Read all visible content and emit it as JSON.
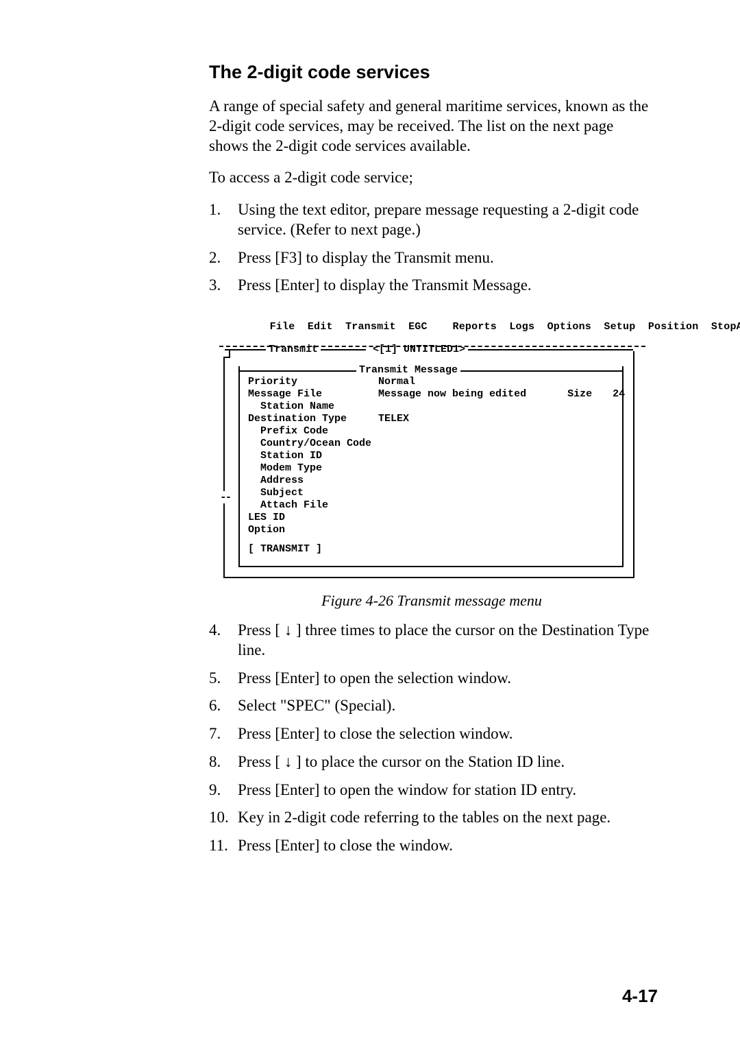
{
  "heading": "The 2-digit code services",
  "intro1": "A range of special safety and general maritime services, known as the 2-digit code services, may be received. The list on the next page shows the 2-digit code services available.",
  "intro2": "To access a 2-digit code service;",
  "stepsA": [
    "Using the text editor, prepare message requesting a 2-digit code service. (Refer to next page.)",
    "Press [F3] to display the Transmit menu.",
    "Press [Enter] to display the Transmit Message."
  ],
  "menu": {
    "items": [
      "File",
      "Edit",
      "Transmit",
      "EGC",
      "Reports",
      "Logs",
      "Options",
      "Setup",
      "Position",
      "StopAlarm"
    ],
    "outerTitle1": "Transmit",
    "outerTitle2": "<[1] UNTITLED1>",
    "innerTitle": "Transmit Message",
    "fields": {
      "priority": {
        "label": "Priority",
        "value": "Normal"
      },
      "messageFile": {
        "label": "Message File",
        "value": "Message now being edited",
        "sizeLabel": "Size",
        "sizeValue": "24"
      },
      "stationName": {
        "label": "Station Name"
      },
      "destinationType": {
        "label": "Destination Type",
        "value": "TELEX"
      },
      "sub": [
        "Prefix Code",
        "Country/Ocean Code",
        "Station ID",
        "Modem Type",
        "Address",
        "Subject",
        "Attach File"
      ],
      "lesId": {
        "label": "LES ID"
      },
      "option": {
        "label": "Option"
      }
    },
    "button": "[ TRANSMIT ]"
  },
  "figureCaption": "Figure 4-26 Transmit message menu",
  "stepsB": [
    "Press [ ↓ ] three times to place the cursor on the Destination Type line.",
    "Press [Enter] to open the selection window.",
    "Select \"SPEC\" (Special).",
    "Press [Enter] to close the selection window.",
    "Press [ ↓ ] to place the cursor on the Station ID line.",
    "Press [Enter] to open the window for station ID entry.",
    "Key in 2-digit code referring to the tables on the next page.",
    "Press [Enter] to close the window."
  ],
  "pageNumber": "4-17"
}
